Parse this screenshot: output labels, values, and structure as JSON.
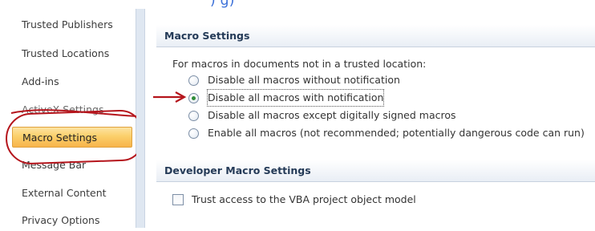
{
  "top_fragment": ")                              g)",
  "nav": {
    "items": [
      {
        "label": "Trusted Publishers"
      },
      {
        "label": "Trusted Locations"
      },
      {
        "label": "Add-ins"
      },
      {
        "label": "ActiveX Settings"
      },
      {
        "label": "Macro Settings"
      },
      {
        "label": "Message Bar"
      },
      {
        "label": "External Content"
      },
      {
        "label": "Privacy Options"
      }
    ],
    "selected_index": 4
  },
  "macro_settings": {
    "title": "Macro Settings",
    "description": "For macros in documents not in a trusted location:",
    "options": [
      {
        "label": "Disable all macros without notification",
        "checked": false
      },
      {
        "label": "Disable all macros with notification",
        "checked": true
      },
      {
        "label": "Disable all macros except digitally signed macros",
        "checked": false
      },
      {
        "label": "Enable all macros (not recommended; potentially dangerous code can run)",
        "checked": false
      }
    ]
  },
  "developer_settings": {
    "title": "Developer Macro Settings",
    "trust_vba_label": "Trust access to the VBA project object model",
    "trust_vba_checked": false
  },
  "annotation_color": "#b5151c",
  "selection_color": "#fbcf6b"
}
